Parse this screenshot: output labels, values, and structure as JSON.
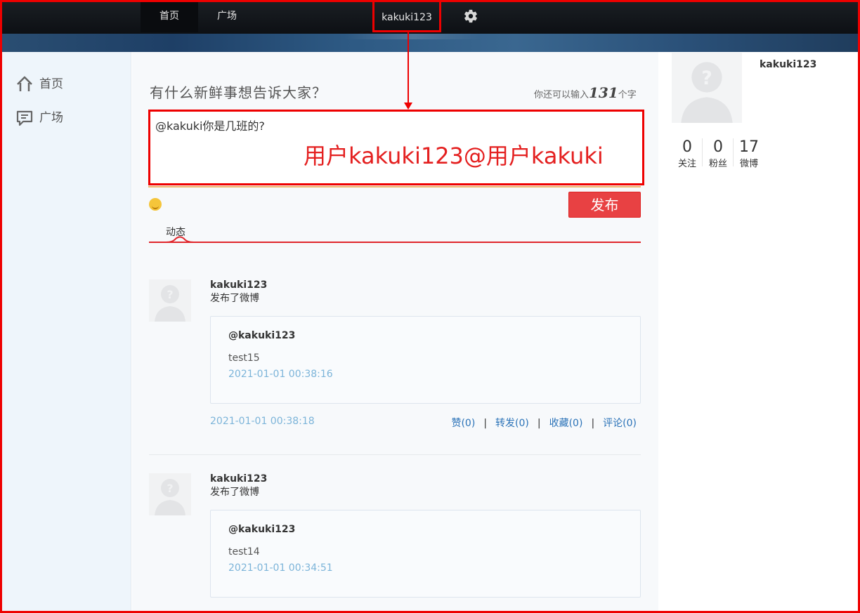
{
  "topnav": {
    "home": "首页",
    "square": "广场",
    "username": "kakuki123",
    "settings_icon": "gear-icon"
  },
  "sidebar": {
    "items": [
      {
        "label": "首页",
        "icon": "home-icon"
      },
      {
        "label": "广场",
        "icon": "chat-icon"
      }
    ]
  },
  "compose": {
    "title": "有什么新鲜事想告诉大家？",
    "counter_prefix": "你还可以输入",
    "counter_num": "131",
    "counter_suffix": "个字",
    "text": "@kakuki你是几班的?",
    "annotation": "用户kakuki123@用户kakuki",
    "publish": "发布",
    "emoji_icon": "smiley-icon"
  },
  "tabs": {
    "active": "动态"
  },
  "feed": [
    {
      "user": "kakuki123",
      "action": "发布了微博",
      "quote_user": "@kakuki123",
      "quote_text": "test15",
      "quote_time": "2021-01-01 00:38:16",
      "time": "2021-01-01 00:38:18",
      "like": "赞(0)",
      "forward": "转发(0)",
      "favorite": "收藏(0)",
      "comment": "评论(0)"
    },
    {
      "user": "kakuki123",
      "action": "发布了微博",
      "quote_user": "@kakuki123",
      "quote_text": "test14",
      "quote_time": "2021-01-01 00:34:51"
    }
  ],
  "profile": {
    "name": "kakuki123",
    "stats": [
      {
        "n": "0",
        "l": "关注"
      },
      {
        "n": "0",
        "l": "粉丝"
      },
      {
        "n": "17",
        "l": "微博"
      }
    ]
  },
  "colors": {
    "accent_red": "#e84143",
    "link_blue": "#2b73b8",
    "time_blue": "#7cb4d9"
  }
}
